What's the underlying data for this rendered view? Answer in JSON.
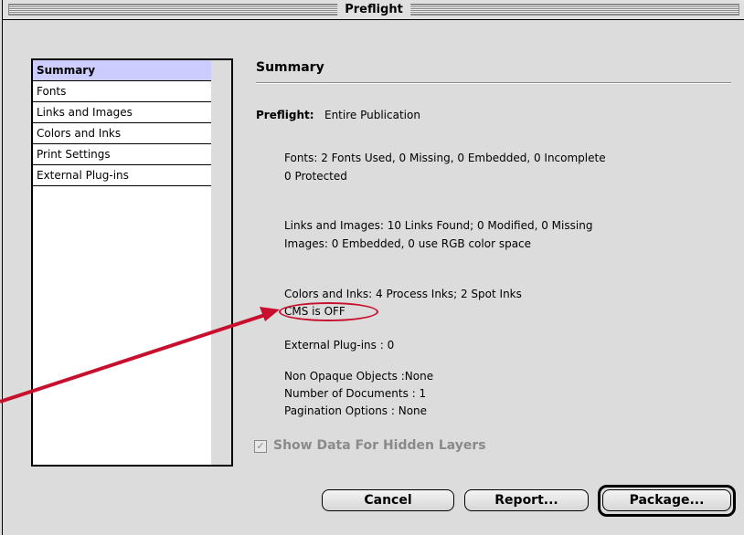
{
  "window": {
    "title": "Preflight"
  },
  "sidebar": {
    "items": [
      {
        "label": "Summary",
        "selected": true
      },
      {
        "label": "Fonts"
      },
      {
        "label": "Links and Images"
      },
      {
        "label": "Colors and Inks"
      },
      {
        "label": "Print Settings"
      },
      {
        "label": "External Plug-ins"
      }
    ]
  },
  "main": {
    "heading": "Summary",
    "preflight_label": "Preflight:",
    "preflight_value": "Entire Publication",
    "fonts_line1": "Fonts: 2 Fonts Used, 0 Missing, 0 Embedded, 0 Incomplete",
    "fonts_line2": "0 Protected",
    "links_line1": "Links and Images:  10 Links Found; 0 Modified, 0 Missing",
    "links_line2": "Images: 0 Embedded, 0 use RGB color space",
    "colors_line1": "Colors and Inks: 4 Process Inks; 2 Spot Inks",
    "colors_line2": "CMS is OFF",
    "plugins_line": "External Plug-ins : 0",
    "non_opaque": "Non Opaque Objects :None",
    "num_docs": "Number of Documents : 1",
    "pagination": "Pagination Options : None"
  },
  "options": {
    "show_hidden_layers": "Show Data For Hidden Layers",
    "show_hidden_checked": true
  },
  "buttons": {
    "cancel": "Cancel",
    "report": "Report...",
    "package": "Package..."
  },
  "colors": {
    "annotation": "#c8102e",
    "selection": "#ccccff"
  }
}
